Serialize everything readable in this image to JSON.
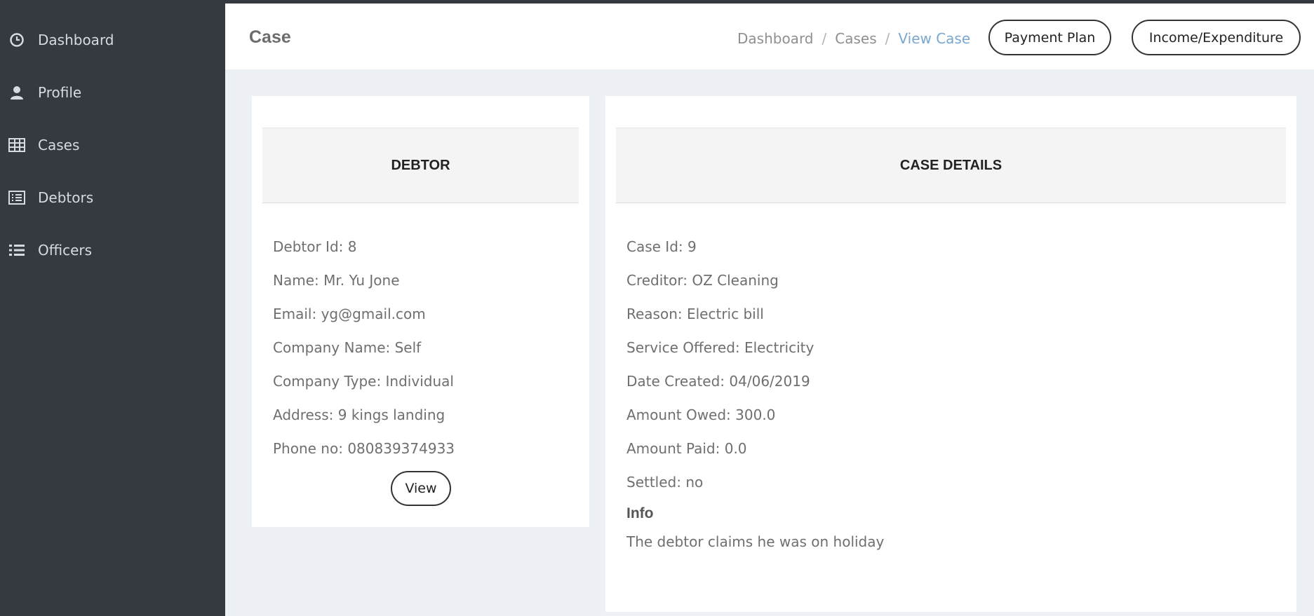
{
  "sidebar": {
    "items": [
      {
        "label": "Dashboard",
        "icon": "clock-icon"
      },
      {
        "label": "Profile",
        "icon": "user-icon"
      },
      {
        "label": "Cases",
        "icon": "table-icon"
      },
      {
        "label": "Debtors",
        "icon": "list-alt-icon"
      },
      {
        "label": "Officers",
        "icon": "list-icon"
      }
    ]
  },
  "header": {
    "title": "Case",
    "breadcrumb": [
      "Dashboard",
      "Cases",
      "View Case"
    ],
    "payment_plan_label": "Payment Plan",
    "income_expenditure_label": "Income/Expenditure"
  },
  "debtor": {
    "heading": "DEBTOR",
    "fields": [
      "Debtor Id: 8",
      "Name: Mr. Yu Jone",
      "Email: yg@gmail.com",
      "Company Name: Self",
      "Company Type: Individual",
      "Address: 9 kings landing",
      "Phone no: 080839374933"
    ],
    "view_label": "View"
  },
  "case": {
    "heading": "CASE DETAILS",
    "fields": [
      "Case Id: 9",
      "Creditor: OZ Cleaning",
      "Reason: Electric bill",
      "Service Offered: Electricity",
      "Date Created: 04/06/2019",
      "Amount Owed: 300.0",
      "Amount Paid: 0.0",
      "Settled: no"
    ],
    "info_title": "Info",
    "info_text": "The debtor claims he was on holiday"
  },
  "colors": {
    "sidebar_bg": "#343a40",
    "page_bg": "#edf0f4",
    "breadcrumb_active": "#7aa7cf"
  }
}
